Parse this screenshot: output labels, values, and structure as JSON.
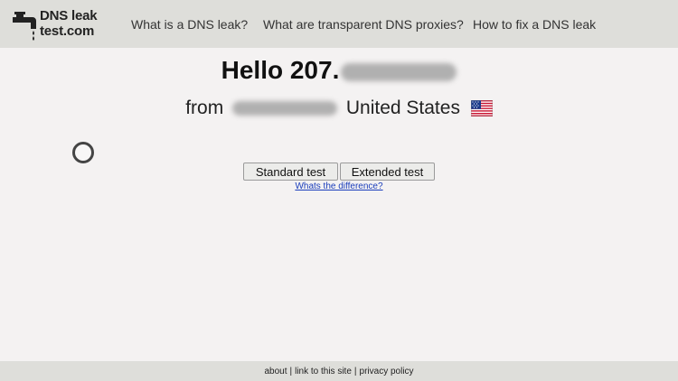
{
  "logo": {
    "line1": "DNS leak",
    "line2": "test.com",
    "icon": "faucet-icon"
  },
  "nav": [
    {
      "label": "What is a DNS leak?"
    },
    {
      "label": "What are transparent DNS proxies?"
    },
    {
      "label": "How to fix a DNS leak"
    }
  ],
  "greeting": {
    "prefix": "Hello 207."
  },
  "location": {
    "from": "from",
    "country": "United States",
    "flag": "us-flag-icon"
  },
  "buttons": {
    "standard": "Standard test",
    "extended": "Extended test"
  },
  "difference_link": "Whats the difference?",
  "footer": {
    "about": "about",
    "sep": "|",
    "link": "link to this site",
    "privacy": "privacy policy"
  },
  "colors": {
    "topbar": "#dededa",
    "background": "#f4f2f2",
    "link": "#1a3dbb"
  }
}
